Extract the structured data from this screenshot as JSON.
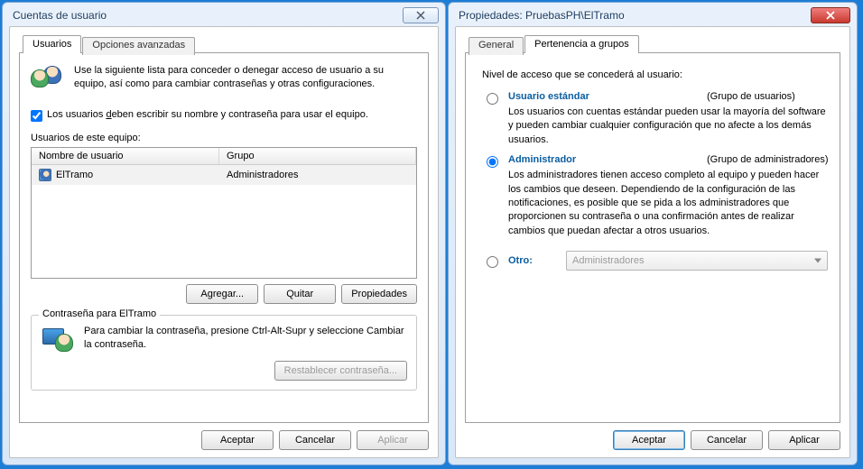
{
  "left": {
    "title": "Cuentas de usuario",
    "tabs": {
      "users": "Usuarios",
      "advanced": "Opciones avanzadas"
    },
    "intro": "Use la siguiente lista para conceder o denegar acceso de usuario a su equipo, así como para cambiar contraseñas y otras configuraciones.",
    "checkbox_pre": "Los usuarios ",
    "checkbox_u": "d",
    "checkbox_post": "eben escribir su nombre y contraseña para usar el equipo.",
    "list_label": "Usuarios de este equipo:",
    "columns": {
      "name": "Nombre de usuario",
      "group": "Grupo"
    },
    "rows": [
      {
        "name": "ElTramo",
        "group": "Administradores"
      }
    ],
    "buttons": {
      "add": "Agregar...",
      "remove": "Quitar",
      "props": "Propiedades"
    },
    "pw_group_title": "Contraseña para ElTramo",
    "pw_text": "Para cambiar la contraseña, presione Ctrl-Alt-Supr y seleccione Cambiar la contraseña.",
    "pw_reset": "Restablecer contraseña...",
    "dialog": {
      "ok": "Aceptar",
      "cancel": "Cancelar",
      "apply": "Aplicar"
    }
  },
  "right": {
    "title": "Propiedades: PruebasPH\\ElTramo",
    "tabs": {
      "general": "General",
      "membership": "Pertenencia a grupos"
    },
    "access_label": "Nivel de acceso que se concederá al usuario:",
    "standard": {
      "title": "Usuario estándar",
      "group": "(Grupo de usuarios)",
      "desc": "Los usuarios con cuentas estándar pueden usar la mayoría del software y pueden cambiar cualquier configuración que no afecte a los demás usuarios."
    },
    "admin": {
      "title": "Administrador",
      "group": "(Grupo de administradores)",
      "desc": "Los administradores tienen acceso completo al equipo y pueden hacer los cambios que deseen. Dependiendo de la configuración de las notificaciones, es posible que se pida a los administradores que proporcionen su contraseña o una confirmación antes de realizar cambios que puedan afectar a otros usuarios."
    },
    "other": {
      "title": "Otro:",
      "combo": "Administradores"
    },
    "dialog": {
      "ok": "Aceptar",
      "cancel": "Cancelar",
      "apply": "Aplicar"
    }
  }
}
